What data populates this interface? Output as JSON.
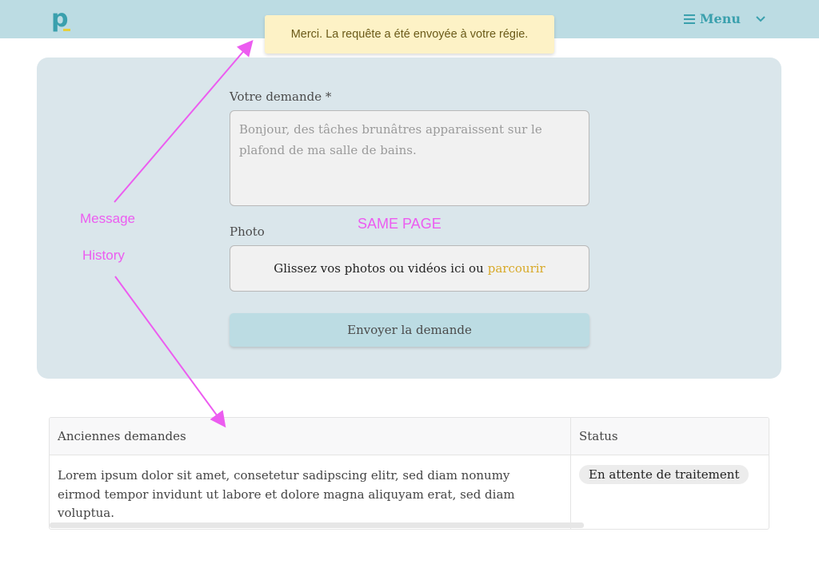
{
  "header": {
    "logo_letter": "p",
    "menu_label": "Menu"
  },
  "toast": {
    "message": "Merci. La requête a été envoyée à votre régie."
  },
  "form": {
    "request_label": "Votre demande *",
    "request_value": "Bonjour, des tâches brunâtres apparaissent sur le plafond de ma salle de bains.",
    "photo_label": "Photo",
    "dropzone_text": "Glissez vos photos ou vidéos ici ou",
    "dropzone_link": "parcourir",
    "submit_label": "Envoyer la demande"
  },
  "table": {
    "columns": [
      "Anciennes demandes",
      "Status"
    ],
    "rows": [
      {
        "request": "Lorem ipsum dolor sit amet, consetetur sadipscing elitr, sed diam nonumy eirmod tempor invidunt ut labore et dolore magna aliquyam erat, sed diam voluptua.",
        "status": "En attente de traitement"
      }
    ]
  },
  "annotations": {
    "message": "Message",
    "history": "History",
    "same_page": "SAME PAGE"
  },
  "colors": {
    "header_bg": "#bcdce3",
    "accent": "#3aa0ad",
    "link": "#d8a928",
    "toast_bg": "#fdf2c6",
    "card_bg": "#dae6eb",
    "annotation": "#ec5cf0"
  },
  "icons": {
    "menu": "hamburger-icon",
    "menu_toggle": "chevron-down-icon"
  }
}
